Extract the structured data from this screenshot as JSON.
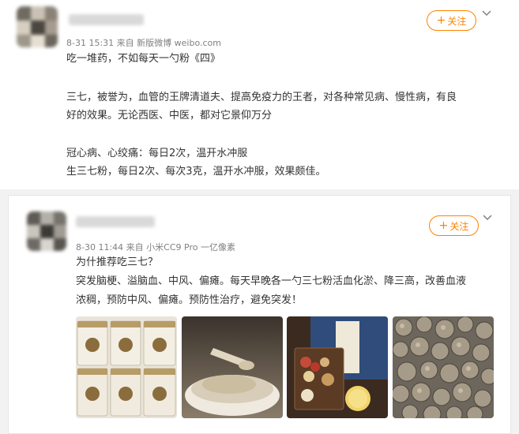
{
  "post1": {
    "meta_time": "8-31 15:31",
    "meta_from": "来自",
    "meta_source": "新版微博 weibo.com",
    "follow_label": "关注",
    "lines": [
      "吃一堆药，不如每天一勺粉《四》",
      "三七，被誉为，血管的王牌清道夫、提高免疫力的王者，对各种常见病、慢性病，有良",
      "好的效果。无论西医、中医，都对它景仰万分",
      "冠心病、心绞痛：每日2次，温开水冲服",
      "生三七粉，每日2次、每次3克，温开水冲服，效果颇佳。"
    ]
  },
  "post2": {
    "meta_time": "8-30 11:44",
    "meta_from": "来自",
    "meta_source": "小米CC9 Pro 一亿像素",
    "follow_label": "关注",
    "lines": [
      "为什推荐吃三七？",
      "突发脑梗、溢脑血、中风、偏瘫。每天早晚各一勺三七粉活血化淤、降三高，改善血液",
      "浓稠，预防中风、偏瘫。预防性治疗，避免突发！"
    ],
    "images": [
      {
        "name": "sanqi-jars-photo"
      },
      {
        "name": "powder-bowl-photo"
      },
      {
        "name": "herbal-book-photo"
      },
      {
        "name": "sanqi-roots-photo"
      }
    ]
  },
  "colors": {
    "accent": "#ff8200",
    "meta": "#808080",
    "text": "#333333"
  },
  "icons": {
    "follow": "plus-icon",
    "menu": "chevron-down-icon"
  }
}
